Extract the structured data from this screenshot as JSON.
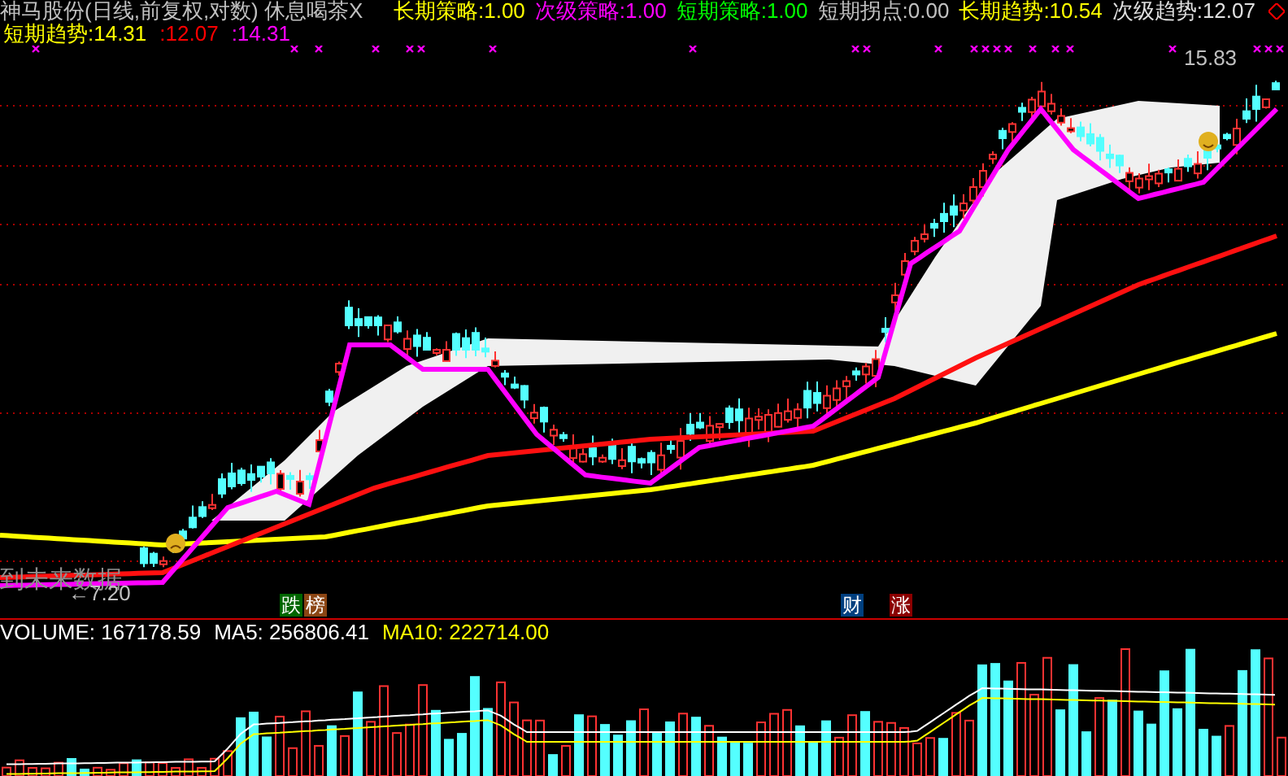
{
  "title": "神马股份(日线,前复权,对数) 休息喝茶X",
  "indicators": [
    {
      "label": "长期策略:",
      "value": "1.00",
      "color": "#ffff00"
    },
    {
      "label": "次级策略:",
      "value": "1.00",
      "color": "#ff00ff"
    },
    {
      "label": "短期策略:",
      "value": "1.00",
      "color": "#00ff00"
    },
    {
      "label": "短期拐点:",
      "value": "0.00",
      "color": "#c0c0c0"
    },
    {
      "label": "长期趋势:",
      "value": "10.54",
      "color": "#ffff00"
    },
    {
      "label": "次级趋势:",
      "value": "12.07",
      "color": "#e0e0e0"
    }
  ],
  "trend_readouts": [
    {
      "text": "短期趋势:14.31",
      "color": "#ffff00"
    },
    {
      "text": ":12.07",
      "color": "#ff0000"
    },
    {
      "text": ":14.31",
      "color": "#ff00ff"
    }
  ],
  "chart": {
    "price_high": "15.83",
    "price_low": "←7.20",
    "note": "到未来数据",
    "badges": [
      {
        "text": "跌",
        "color": "#006600"
      },
      {
        "text": "榜",
        "color": "#8b4513"
      },
      {
        "text": "财",
        "color": "#003f7f"
      },
      {
        "text": "涨",
        "color": "#8b0000"
      }
    ]
  },
  "volume": [
    {
      "text": "VOLUME: 167178.59",
      "color": "#ffffff"
    },
    {
      "text": "MA5: 256806.41",
      "color": "#ffffff"
    },
    {
      "text": "MA10: 222714.00",
      "color": "#ffff00"
    }
  ]
}
